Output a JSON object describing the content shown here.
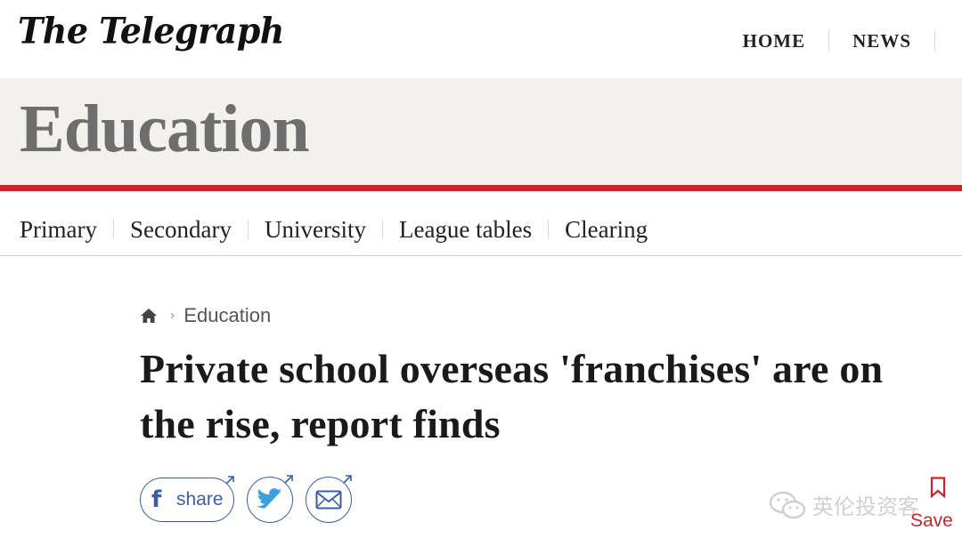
{
  "masthead": {
    "logo_text": "The Telegraph",
    "nav": [
      {
        "label": "HOME"
      },
      {
        "label": "NEWS"
      }
    ]
  },
  "section": {
    "title": "Education",
    "accent_color": "#c8262a",
    "subnav": [
      {
        "label": "Primary"
      },
      {
        "label": "Secondary"
      },
      {
        "label": "University"
      },
      {
        "label": "League tables"
      },
      {
        "label": "Clearing"
      }
    ]
  },
  "article": {
    "breadcrumb": {
      "home_icon": "home-icon",
      "section": "Education"
    },
    "headline": "Private school overseas 'franchises' are on the rise, report finds",
    "share": {
      "facebook_label": "share",
      "icons": [
        "facebook-icon",
        "twitter-icon",
        "email-icon"
      ],
      "color": "#3b5ea5"
    },
    "save_label": "Save"
  },
  "watermark": {
    "text": "英伦投资客"
  }
}
